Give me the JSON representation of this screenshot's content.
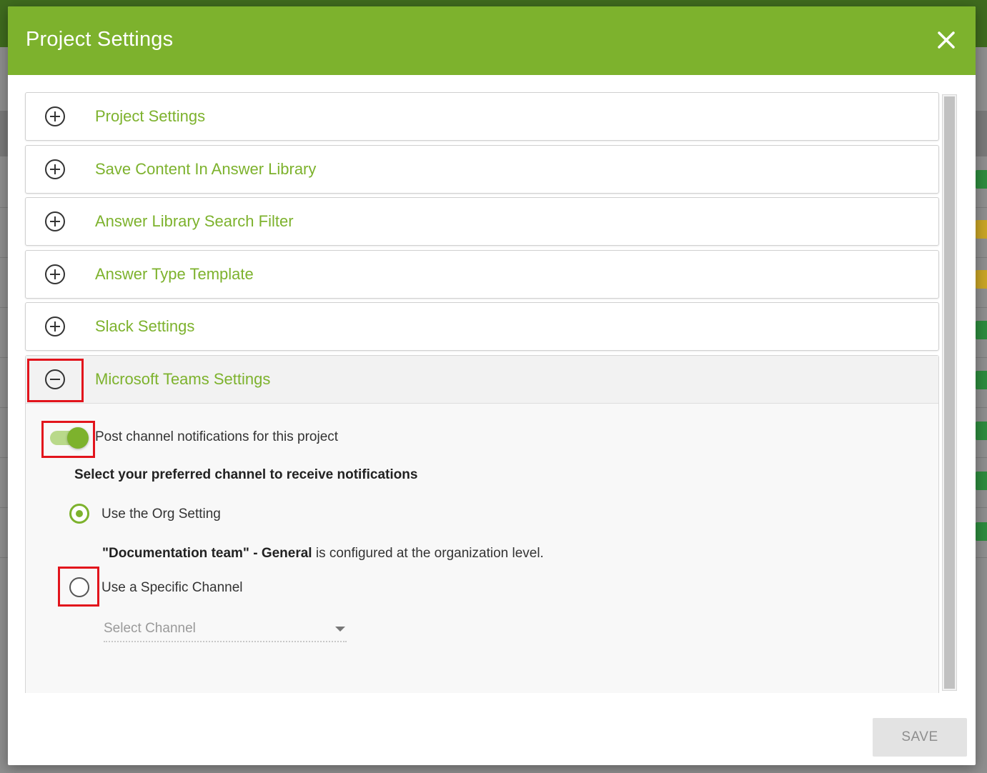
{
  "modal": {
    "title": "Project Settings",
    "header_color": "#7db22d"
  },
  "panels": [
    {
      "label": "Project Settings",
      "icon": "plus-circle-icon",
      "expanded": false
    },
    {
      "label": "Save Content In Answer Library",
      "icon": "plus-circle-icon",
      "expanded": false
    },
    {
      "label": "Answer Library Search Filter",
      "icon": "plus-circle-icon",
      "expanded": false
    },
    {
      "label": "Answer Type Template",
      "icon": "plus-circle-icon",
      "expanded": false
    },
    {
      "label": "Slack Settings",
      "icon": "plus-circle-icon",
      "expanded": false
    },
    {
      "label": "Microsoft Teams Settings",
      "icon": "minus-circle-icon",
      "expanded": true
    }
  ],
  "teams": {
    "toggle_label": "Post channel notifications for this project",
    "toggle_on": true,
    "heading": "Select your preferred channel to receive notifications",
    "options": [
      {
        "label": "Use the Org Setting",
        "selected": true
      },
      {
        "label": "Use a Specific Channel",
        "selected": false
      }
    ],
    "org_channel": "\"Documentation team\" - General",
    "org_note": " is configured at the organization level.",
    "channel_select": {
      "placeholder": "Select Channel"
    }
  },
  "footer": {
    "save_label": "SAVE"
  },
  "colors": {
    "accent": "#7db22d",
    "highlight": "#e2141c"
  }
}
